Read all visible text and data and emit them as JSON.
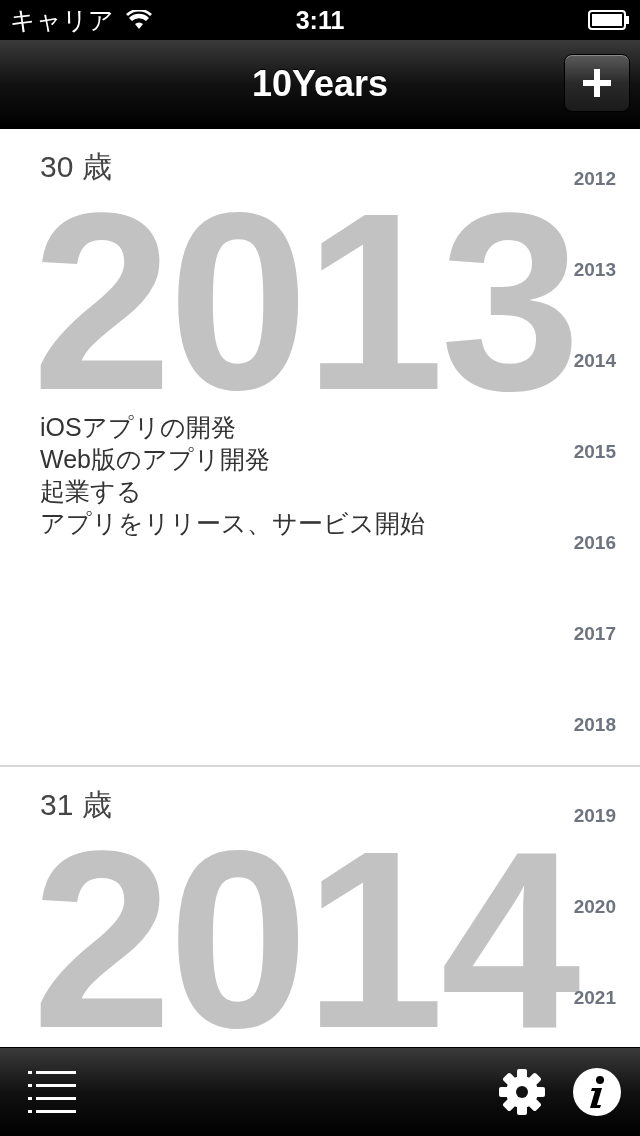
{
  "status_bar": {
    "carrier": "キャリア",
    "time": "3:11"
  },
  "nav_bar": {
    "title": "10Years"
  },
  "sections": [
    {
      "age": "30 歳",
      "year": "2013",
      "events": [
        "iOSアプリの開発",
        "Web版のアプリ開発",
        "起業する",
        "アプリをリリース、サービス開始"
      ]
    },
    {
      "age": "31 歳",
      "year": "2014"
    }
  ],
  "year_index": [
    "2012",
    "2013",
    "2014",
    "2015",
    "2016",
    "2017",
    "2018",
    "2019",
    "2020",
    "2021"
  ]
}
